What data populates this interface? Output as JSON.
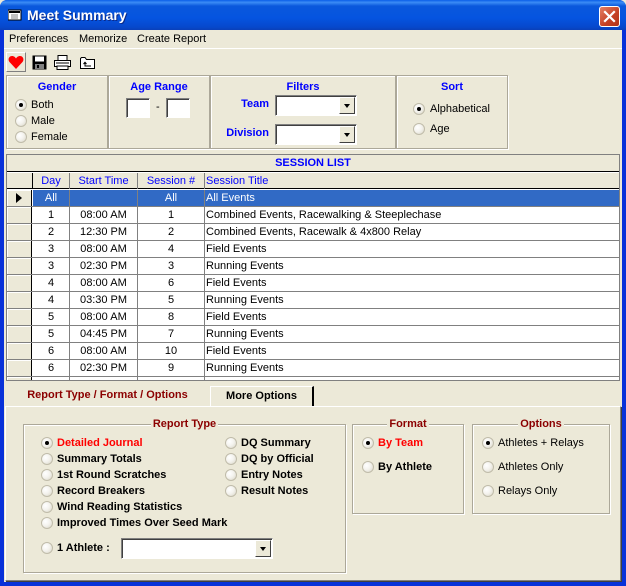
{
  "window": {
    "title": "Meet Summary",
    "close_icon": "close-icon"
  },
  "menu": [
    "Preferences",
    "Memorize",
    "Create Report"
  ],
  "toolbar": {
    "icons": [
      "heart-icon",
      "save-icon",
      "printer-icon",
      "folder-up-icon"
    ]
  },
  "gender": {
    "title": "Gender",
    "options": [
      "Both",
      "Male",
      "Female"
    ],
    "selected": "Both"
  },
  "age_range": {
    "title": "Age Range",
    "separator": "-",
    "from": "",
    "to": ""
  },
  "filters": {
    "title": "Filters",
    "team_label": "Team",
    "team_value": "",
    "division_label": "Division",
    "division_value": ""
  },
  "sort": {
    "title": "Sort",
    "options": [
      "Alphabetical",
      "Age"
    ],
    "selected": "Alphabetical"
  },
  "session_list": {
    "caption": "SESSION LIST",
    "columns": [
      "Day",
      "Start Time",
      "Session #",
      "Session Title"
    ],
    "rows": [
      {
        "day": "All",
        "time": "",
        "session": "All",
        "title": "All Events",
        "selected": true
      },
      {
        "day": "1",
        "time": "08:00 AM",
        "session": "1",
        "title": "Combined Events, Racewalking & Steeplechase"
      },
      {
        "day": "2",
        "time": "12:30 PM",
        "session": "2",
        "title": "Combined Events, Racewalk & 4x800 Relay"
      },
      {
        "day": "3",
        "time": "08:00 AM",
        "session": "4",
        "title": "Field Events"
      },
      {
        "day": "3",
        "time": "02:30 PM",
        "session": "3",
        "title": "Running Events"
      },
      {
        "day": "4",
        "time": "08:00 AM",
        "session": "6",
        "title": "Field Events"
      },
      {
        "day": "4",
        "time": "03:30 PM",
        "session": "5",
        "title": "Running Events"
      },
      {
        "day": "5",
        "time": "08:00 AM",
        "session": "8",
        "title": "Field Events"
      },
      {
        "day": "5",
        "time": "04:45 PM",
        "session": "7",
        "title": "Running Events"
      },
      {
        "day": "6",
        "time": "08:00 AM",
        "session": "10",
        "title": "Field Events"
      },
      {
        "day": "6",
        "time": "02:30 PM",
        "session": "9",
        "title": "Running Events"
      }
    ]
  },
  "tabs": [
    {
      "label": "Report Type / Format / Options",
      "active": true
    },
    {
      "label": "More Options",
      "active": false
    }
  ],
  "report_type": {
    "title": "Report Type",
    "left_options": [
      "Detailed Journal",
      "Summary Totals",
      "1st Round Scratches",
      "Record Breakers",
      "Wind Reading Statistics",
      "Improved Times Over Seed Mark"
    ],
    "right_options": [
      "DQ Summary",
      "DQ by Official",
      "Entry Notes",
      "Result Notes"
    ],
    "athlete_label": "1 Athlete :",
    "athlete_value": "",
    "selected": "Detailed Journal"
  },
  "format": {
    "title": "Format",
    "options": [
      "By Team",
      "By Athlete"
    ],
    "selected": "By Team"
  },
  "options": {
    "title": "Options",
    "options": [
      "Athletes + Relays",
      "Athletes Only",
      "Relays Only"
    ],
    "selected": "Athletes + Relays"
  }
}
